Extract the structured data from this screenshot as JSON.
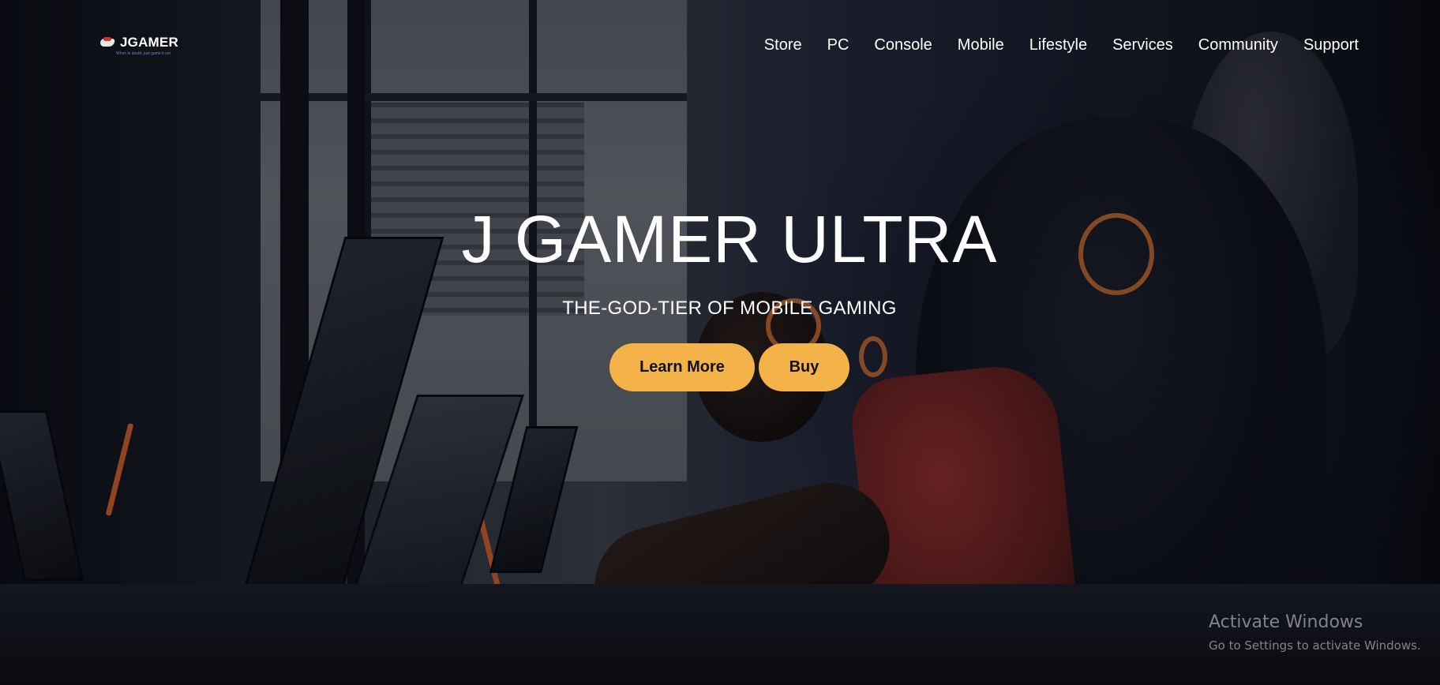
{
  "brand": {
    "name": "JGAMER",
    "tagline": "When in doubt, just game it out"
  },
  "nav": {
    "items": [
      {
        "label": "Store"
      },
      {
        "label": "PC"
      },
      {
        "label": "Console"
      },
      {
        "label": "Mobile"
      },
      {
        "label": "Lifestyle"
      },
      {
        "label": "Services"
      },
      {
        "label": "Community"
      },
      {
        "label": "Support"
      }
    ]
  },
  "hero": {
    "title": "J GAMER ULTRA",
    "subtitle": "THE-GOD-TIER OF MOBILE GAMING",
    "learn_more_label": "Learn More",
    "buy_label": "Buy",
    "button_color": "#f4b348"
  },
  "watermark": {
    "title": "Activate Windows",
    "subtitle": "Go to Settings to activate Windows."
  },
  "icons": {
    "logo": "controller-logo-icon"
  }
}
